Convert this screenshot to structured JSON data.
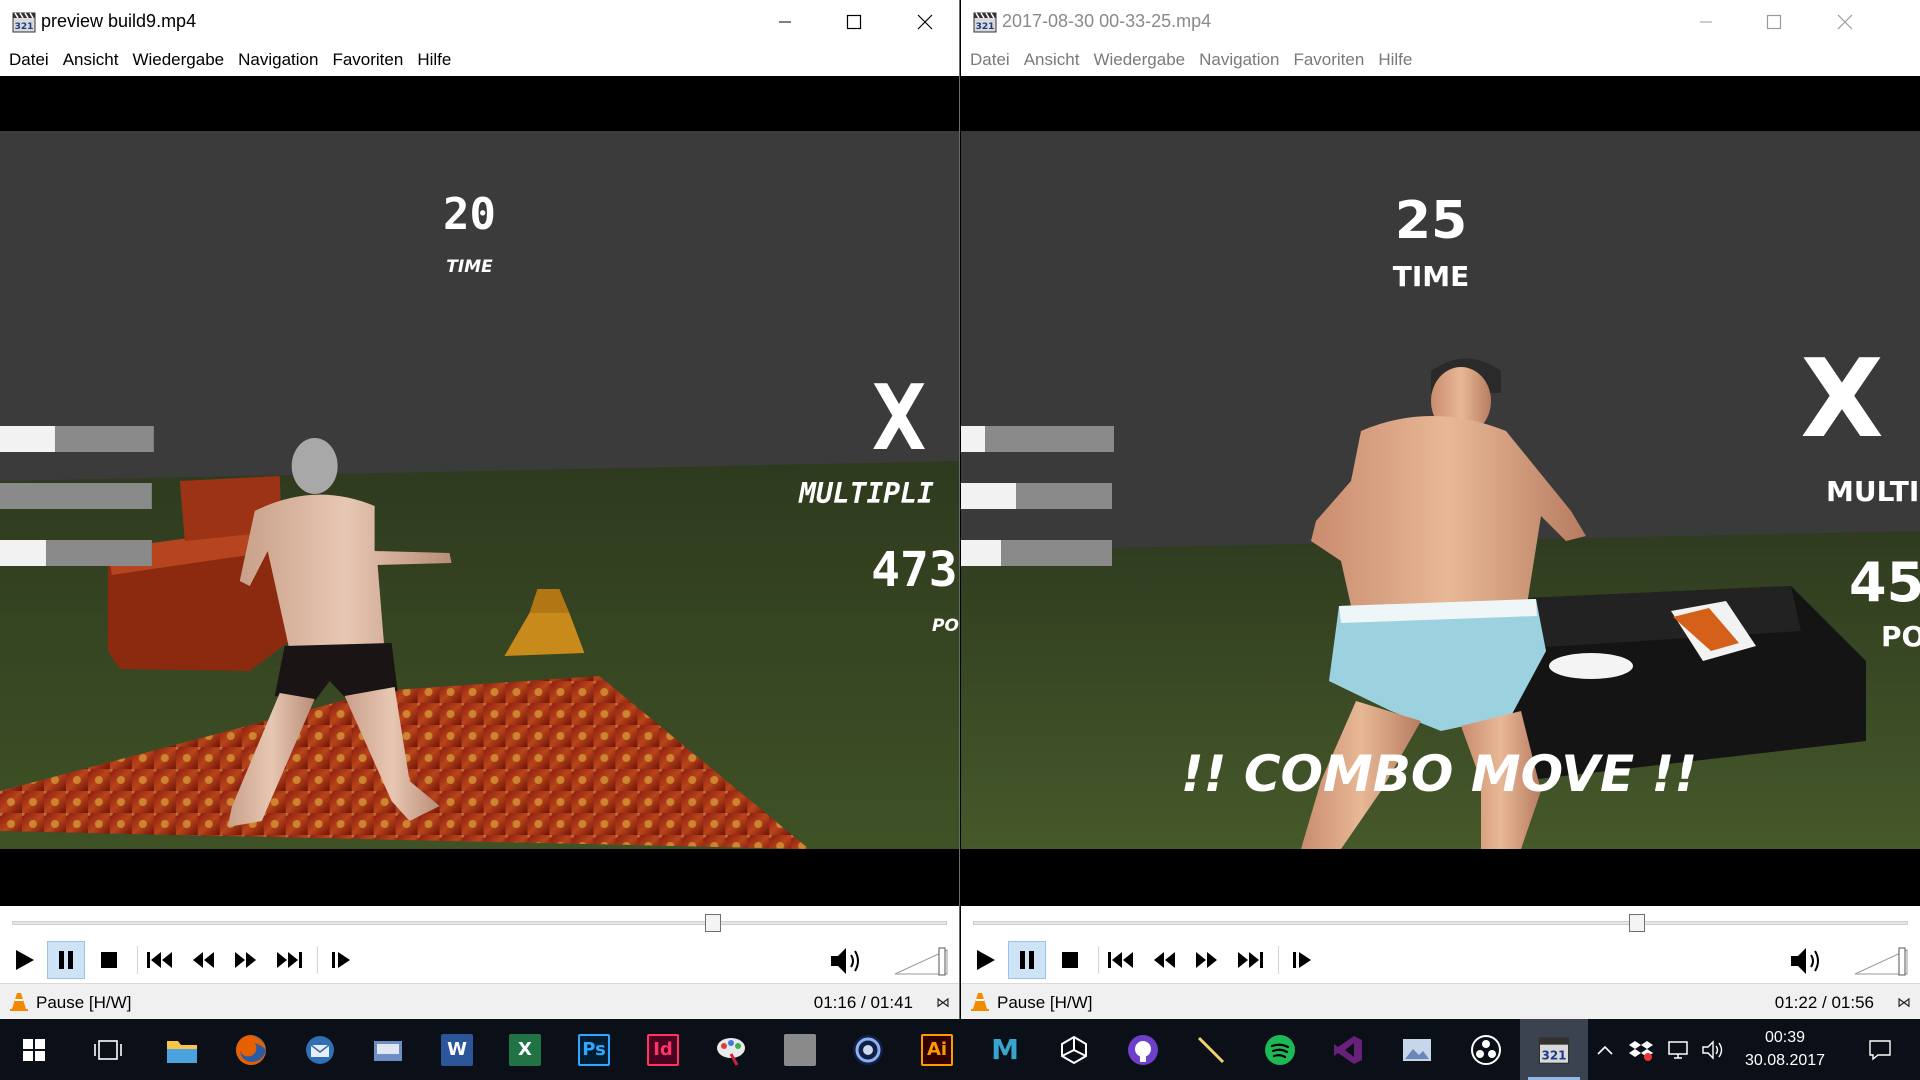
{
  "left_window": {
    "title": "preview build9.mp4",
    "menu": [
      "Datei",
      "Ansicht",
      "Wiedergabe",
      "Navigation",
      "Favoriten",
      "Hilfe"
    ],
    "hud": {
      "timer_value": "20",
      "timer_label": "TIME",
      "multiplier_symbol": "X",
      "multiplier_label": "MULTIPLI",
      "points_value": "473",
      "points_label": "PO"
    },
    "skill_bar_levels": [
      0.36,
      0.0,
      0.3
    ],
    "seek_position": 0.75,
    "status_text": "Pause [H/W]",
    "time_display": "01:16 / 01:41",
    "status_icon": "x-icon"
  },
  "right_window": {
    "title": "2017-08-30 00-33-25.mp4",
    "menu": [
      "Datei",
      "Ansicht",
      "Wiedergabe",
      "Navigation",
      "Favoriten",
      "Hilfe"
    ],
    "hud": {
      "timer_value": "25",
      "timer_label": "TIME",
      "multiplier_symbol": "X",
      "multiplier_label": "MULTIP",
      "points_value": "45",
      "points_label": "PO",
      "combo_text": "!! COMBO MOVE !!"
    },
    "skill_bar_levels": [
      0.16,
      0.36,
      0.26
    ],
    "seek_position": 0.71,
    "status_text": "Pause [H/W]",
    "time_display": "01:22 / 01:56",
    "status_icon": "x-icon"
  },
  "playback_buttons": [
    "play",
    "pause",
    "stop",
    "previous",
    "rewind",
    "fast-forward",
    "next",
    "frame-step"
  ],
  "taskbar": {
    "apps": [
      {
        "name": "start",
        "glyph": ""
      },
      {
        "name": "task-view",
        "glyph": ""
      },
      {
        "name": "file-explorer",
        "glyph": ""
      },
      {
        "name": "firefox",
        "glyph": ""
      },
      {
        "name": "thunderbird",
        "glyph": ""
      },
      {
        "name": "scanner-app",
        "glyph": ""
      },
      {
        "name": "word",
        "glyph": "W"
      },
      {
        "name": "excel",
        "glyph": "X"
      },
      {
        "name": "photoshop",
        "glyph": "Ps"
      },
      {
        "name": "indesign",
        "glyph": "Id"
      },
      {
        "name": "paint-app",
        "glyph": ""
      },
      {
        "name": "gray-app",
        "glyph": ""
      },
      {
        "name": "cinema4d",
        "glyph": ""
      },
      {
        "name": "illustrator",
        "glyph": "Ai"
      },
      {
        "name": "maya",
        "glyph": "M"
      },
      {
        "name": "unity",
        "glyph": ""
      },
      {
        "name": "github",
        "glyph": ""
      },
      {
        "name": "pen-tool",
        "glyph": ""
      },
      {
        "name": "spotify",
        "glyph": ""
      },
      {
        "name": "visual-studio",
        "glyph": ""
      },
      {
        "name": "image-viewer",
        "glyph": ""
      },
      {
        "name": "obs",
        "glyph": ""
      },
      {
        "name": "media-player",
        "glyph": ""
      }
    ],
    "colors": {
      "word": "#2b579a",
      "excel": "#217346",
      "photoshop": "#001d34",
      "indesign": "#49021f",
      "illustrator": "#330000",
      "spotify": "#1db954",
      "visual-studio": "#68217a"
    },
    "clock_time": "00:39",
    "clock_date": "30.08.2017"
  }
}
